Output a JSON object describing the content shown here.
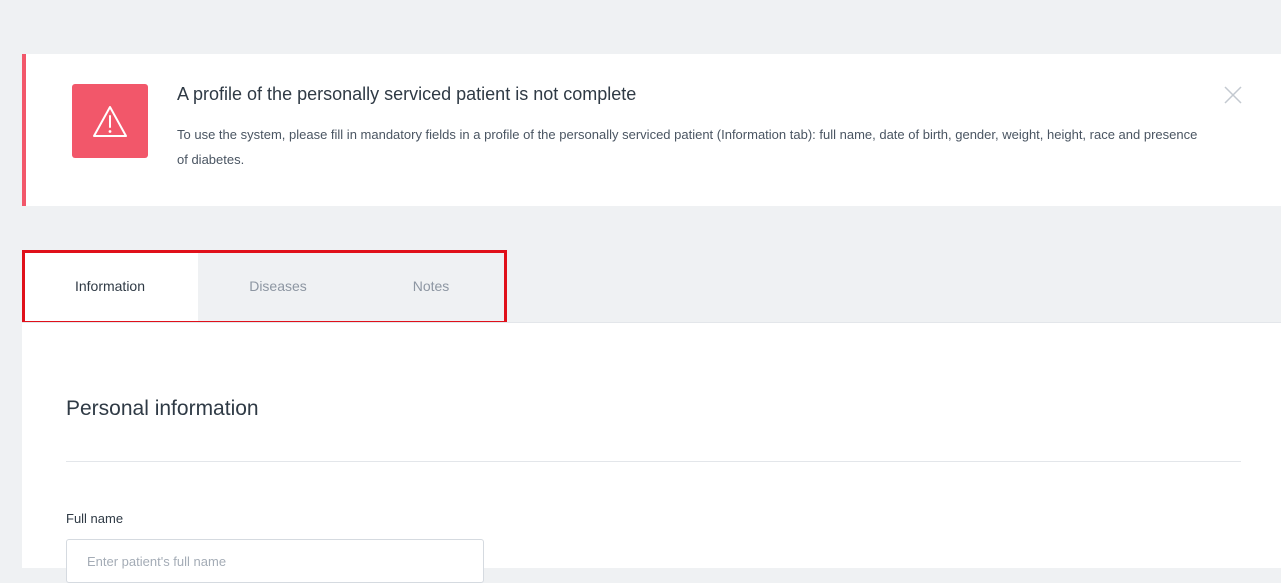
{
  "alert": {
    "icon": "warning-triangle-icon",
    "title": "A profile of the personally serviced patient is not complete",
    "message": "To use the system, please fill in mandatory fields in a profile of the personally serviced patient (Information tab): full name, date of birth, gender, weight, height, race and presence of diabetes.",
    "close_icon": "close-icon",
    "accent_color": "#f2576a"
  },
  "tabs": [
    {
      "label": "Information",
      "active": true
    },
    {
      "label": "Diseases",
      "active": false
    },
    {
      "label": "Notes",
      "active": false
    }
  ],
  "form": {
    "section_title": "Personal information",
    "full_name": {
      "label": "Full name",
      "placeholder": "Enter patient's full name",
      "value": ""
    }
  },
  "highlight_color": "#e0101a"
}
